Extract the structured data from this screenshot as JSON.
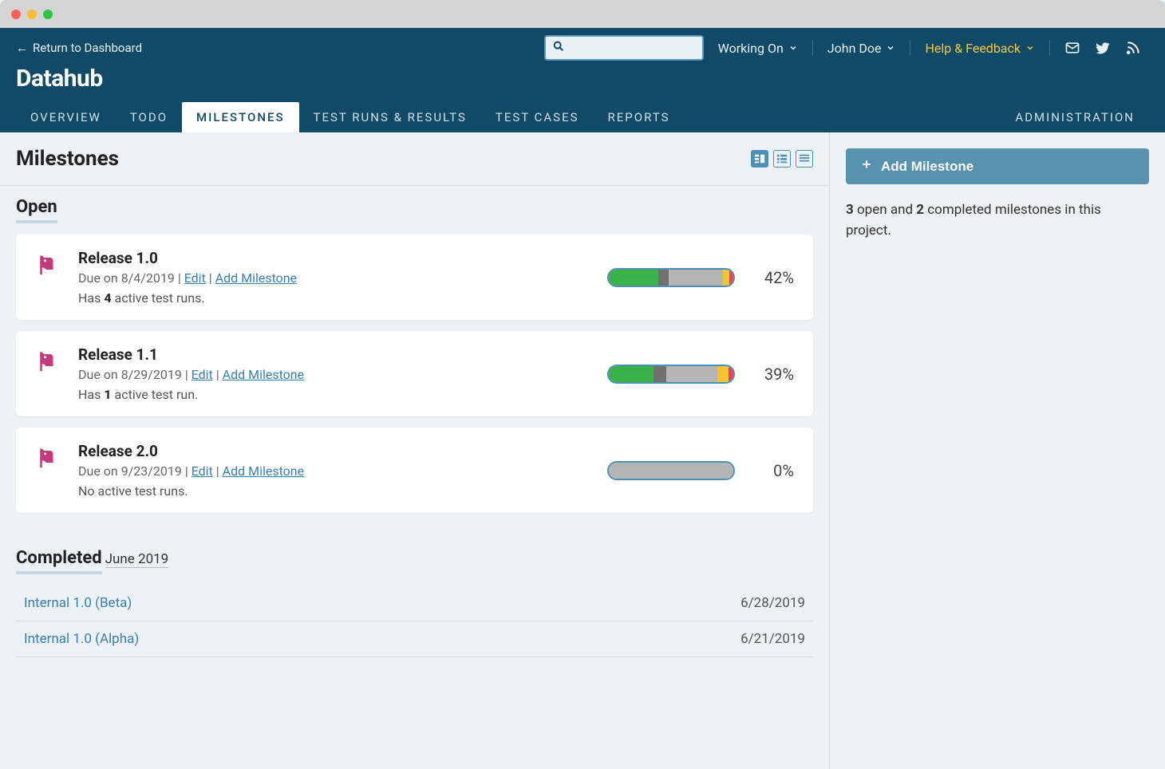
{
  "return_link": "Return to Dashboard",
  "app_title": "Datahub",
  "top": {
    "working_on": "Working On",
    "user": "John Doe",
    "help": "Help & Feedback"
  },
  "nav": {
    "overview": "OVERVIEW",
    "todo": "TODO",
    "milestones": "MILESTONES",
    "test_runs": "TEST RUNS & RESULTS",
    "test_cases": "TEST CASES",
    "reports": "REPORTS",
    "admin": "ADMINISTRATION"
  },
  "page_title": "Milestones",
  "sections": {
    "open": "Open",
    "completed": "Completed"
  },
  "open_milestones": [
    {
      "name": "Release 1.0",
      "due_prefix": "Due on ",
      "due": "8/4/2019",
      "edit": "Edit",
      "add": "Add Milestone",
      "runs_prefix": "Has ",
      "runs_bold": "4",
      "runs_suffix": " active test runs.",
      "pct": "42%",
      "segs": {
        "green": 40,
        "dark": 8,
        "gray": 44,
        "yellow": 5,
        "red": 3
      }
    },
    {
      "name": "Release 1.1",
      "due_prefix": "Due on ",
      "due": "8/29/2019",
      "edit": "Edit",
      "add": "Add Milestone",
      "runs_prefix": "Has ",
      "runs_bold": "1",
      "runs_suffix": " active test run.",
      "pct": "39%",
      "segs": {
        "green": 36,
        "dark": 10,
        "gray": 41,
        "yellow": 9,
        "red": 4
      }
    },
    {
      "name": "Release 2.0",
      "due_prefix": "Due on ",
      "due": "9/23/2019",
      "edit": "Edit",
      "add": "Add Milestone",
      "runs_full": "No active test runs.",
      "pct": "0%",
      "segs": {
        "green": 0,
        "dark": 0,
        "gray": 100,
        "yellow": 0,
        "red": 0
      }
    }
  ],
  "completed_month": "June 2019",
  "completed": [
    {
      "name": "Internal 1.0 (Beta)",
      "date": "6/28/2019"
    },
    {
      "name": "Internal 1.0 (Alpha)",
      "date": "6/21/2019"
    }
  ],
  "sidebar": {
    "add_btn": "Add Milestone",
    "summary_open": "3",
    "summary_mid": " open and ",
    "summary_completed": "2",
    "summary_end": " completed milestones in this project."
  }
}
